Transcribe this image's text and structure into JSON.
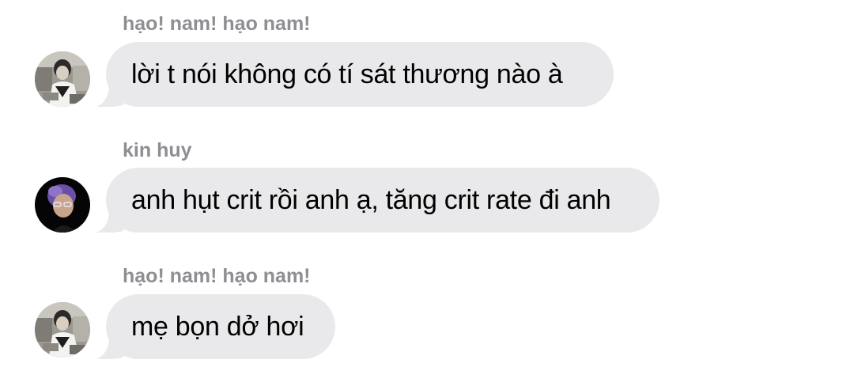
{
  "messages": [
    {
      "sender": "hạo! nam! hạo nam!",
      "text": "lời t nói không có tí sát thương nào à",
      "avatar": "avatar-hao-nam"
    },
    {
      "sender": "kin huy",
      "text": "anh hụt crit rồi anh ạ, tăng crit rate đi anh",
      "avatar": "avatar-kin-huy"
    },
    {
      "sender": "hạo! nam! hạo nam!",
      "text": "mẹ bọn dở hơi",
      "avatar": "avatar-hao-nam"
    }
  ],
  "colors": {
    "bubble": "#e9e9eb",
    "sender_name": "#8e8e93",
    "text": "#000000",
    "background": "#ffffff"
  }
}
